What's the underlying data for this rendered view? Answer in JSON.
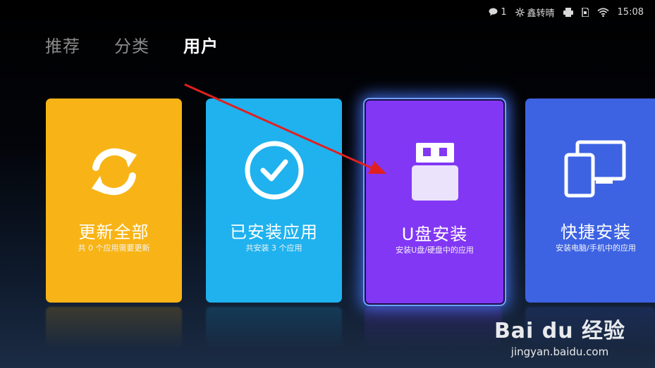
{
  "status_bar": {
    "message_count": "1",
    "network_name": "鑫转晴",
    "time": "15:08"
  },
  "tabs": [
    {
      "label": "推荐",
      "active": false
    },
    {
      "label": "分类",
      "active": false
    },
    {
      "label": "用户",
      "active": true
    }
  ],
  "cards": [
    {
      "title": "更新全部",
      "subtitle": "共 0 个应用需要更新",
      "color": "#f8b417",
      "icon": "refresh-icon"
    },
    {
      "title": "已安装应用",
      "subtitle": "共安装 3 个应用",
      "color": "#1fb2ee",
      "icon": "checkmark-icon"
    },
    {
      "title": "U盘安装",
      "subtitle": "安装U盘/硬盘中的应用",
      "color": "#8237f5",
      "icon": "usb-drive-icon",
      "focused": true
    },
    {
      "title": "快捷安装",
      "subtitle": "安装电脑/手机中的应用",
      "color": "#3d63e3",
      "icon": "devices-icon"
    }
  ],
  "watermark": {
    "logo_text": "Bai du 经验",
    "url": "jingyan.baidu.com"
  },
  "annotation": {
    "arrow_color": "#e02020"
  }
}
